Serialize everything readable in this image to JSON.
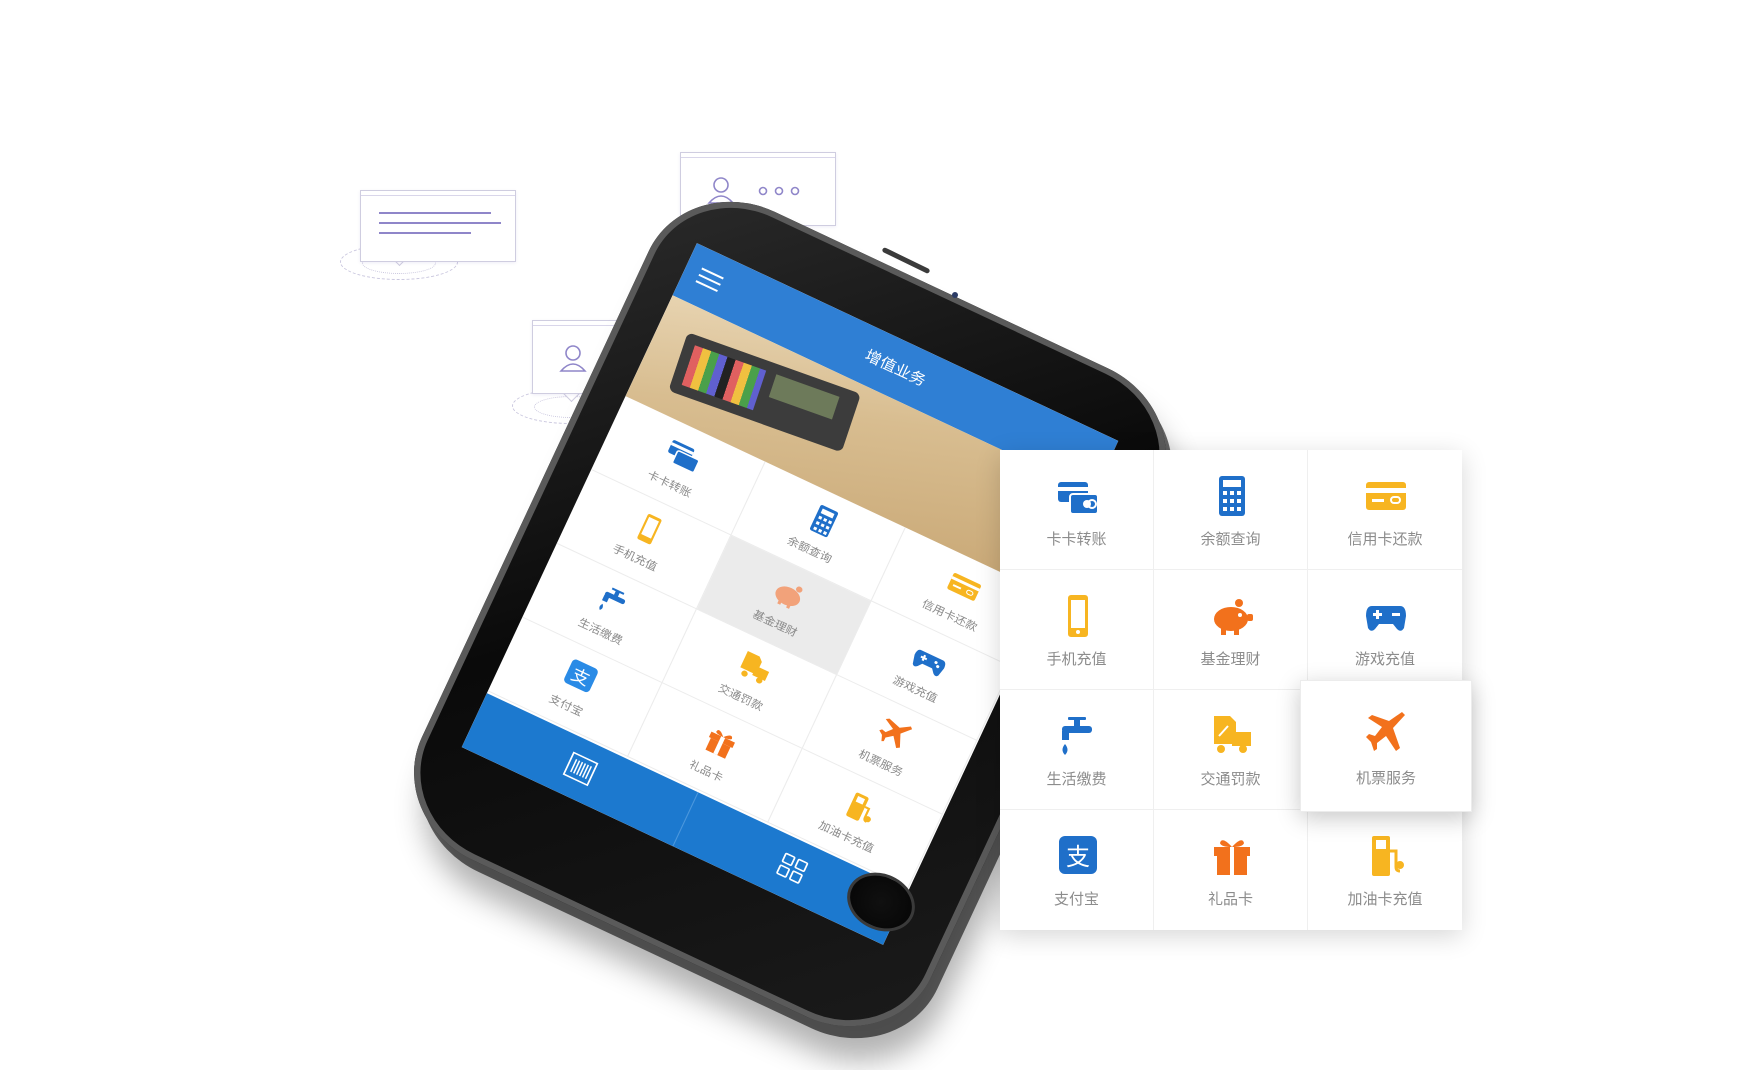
{
  "colors": {
    "blue": "#1f6fc9",
    "orange": "#f2711c",
    "yellow": "#f7b521",
    "top_bar": "#2f7fd4",
    "bottom_bar": "#1c79cf"
  },
  "bubbles": [
    {
      "type": "text-lines-icon"
    },
    {
      "type": "user-typing-icon"
    },
    {
      "type": "user-typing-icon"
    }
  ],
  "phone": {
    "header_title": "增值业务",
    "grid": [
      {
        "label": "卡卡转账",
        "icon": "card-transfer-icon"
      },
      {
        "label": "手机充值",
        "icon": "mobile-icon"
      },
      {
        "label": "余额查询",
        "icon": "calculator-icon"
      },
      {
        "label": "生活缴费",
        "icon": "faucet-icon"
      },
      {
        "label": "基金理财",
        "icon": "piggy-bank-icon"
      },
      {
        "label": "信用卡还款",
        "icon": "credit-card-icon"
      },
      {
        "label": "支付宝",
        "icon": "alipay-icon"
      },
      {
        "label": "交通罚款",
        "icon": "traffic-fine-icon"
      },
      {
        "label": "游戏充值",
        "icon": "gamepad-icon"
      },
      {
        "label": "礼品卡",
        "icon": "gift-icon"
      },
      {
        "label": "机票服务",
        "icon": "airplane-icon"
      },
      {
        "label": "加油卡充值",
        "icon": "fuel-pump-icon"
      }
    ],
    "bottom_tabs": [
      {
        "icon": "barcode-icon"
      },
      {
        "icon": "grid-apps-icon"
      }
    ]
  },
  "panel": {
    "items": [
      {
        "label": "卡卡转账",
        "icon": "card-transfer-icon"
      },
      {
        "label": "余额查询",
        "icon": "calculator-icon"
      },
      {
        "label": "信用卡还款",
        "icon": "credit-card-icon"
      },
      {
        "label": "手机充值",
        "icon": "mobile-icon"
      },
      {
        "label": "基金理财",
        "icon": "piggy-bank-icon"
      },
      {
        "label": "游戏充值",
        "icon": "gamepad-icon"
      },
      {
        "label": "生活缴费",
        "icon": "faucet-icon"
      },
      {
        "label": "交通罚款",
        "icon": "traffic-fine-icon"
      },
      {
        "label": "机票服务",
        "icon": "airplane-icon"
      },
      {
        "label": "支付宝",
        "icon": "alipay-icon"
      },
      {
        "label": "礼品卡",
        "icon": "gift-icon"
      },
      {
        "label": "加油卡充值",
        "icon": "fuel-pump-icon"
      }
    ]
  }
}
